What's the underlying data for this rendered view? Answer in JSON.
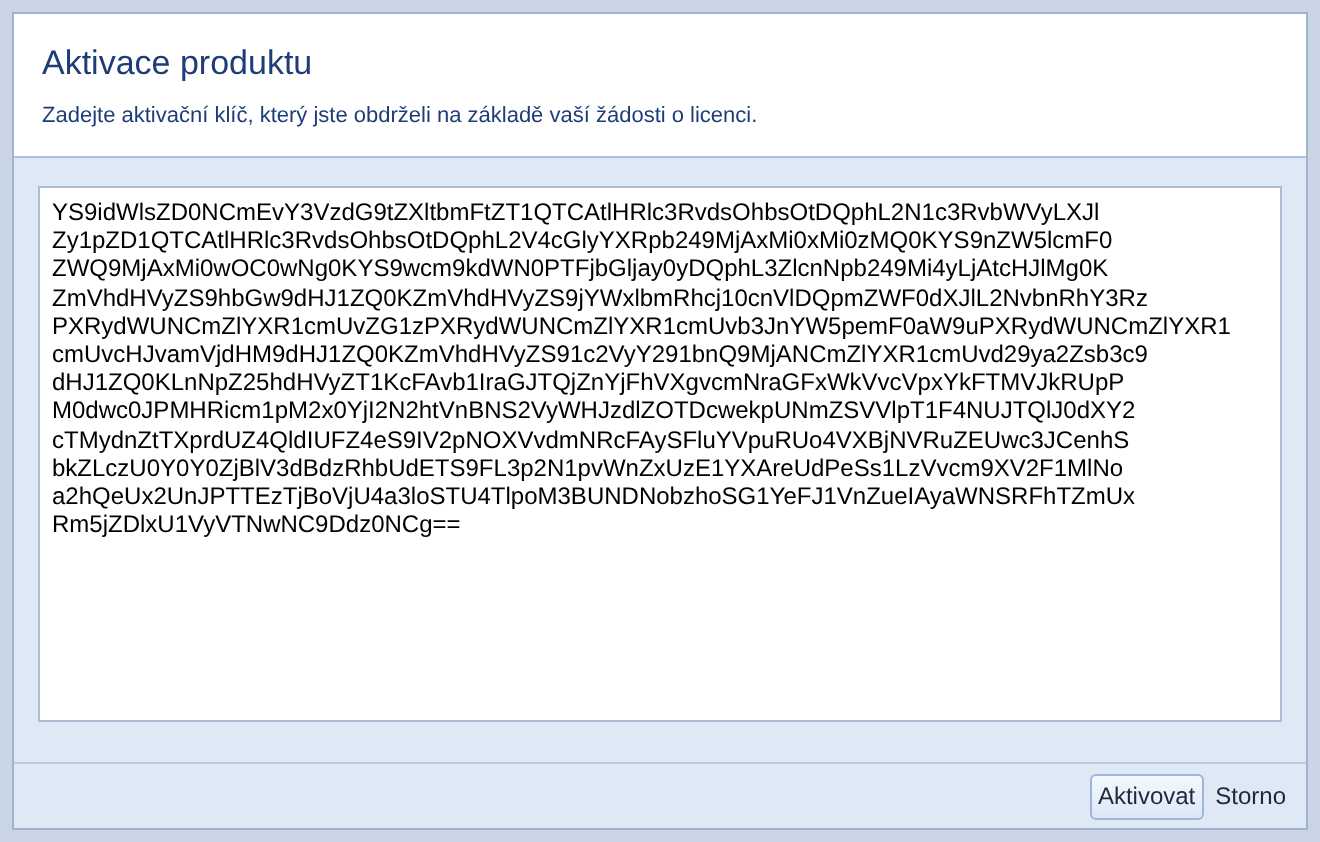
{
  "header": {
    "title": "Aktivace produktu",
    "description": "Zadejte aktivační klíč, který jste obdrželi na základě vaší žádosti o licenci."
  },
  "license_key": {
    "value": "YS9idWlsZD0NCmEvY3VzdG9tZXltbmFtZT1QTCAtlHRlc3RvdsOhbsOtDQphL2N1c3RvbWVyLXJl\nZy1pZD1QTCAtlHRlc3RvdsOhbsOtDQphL2V4cGlyYXRpb249MjAxMi0xMi0zMQ0KYS9nZW5lcmF0\nZWQ9MjAxMi0wOC0wNg0KYS9wcm9kdWN0PTFjbGljay0yDQphL3ZlcnNpb249Mi4yLjAtcHJlMg0K\nZmVhdHVyZS9hbGw9dHJ1ZQ0KZmVhdHVyZS9jYWxlbmRhcj10cnVlDQpmZWF0dXJlL2NvbnRhY3Rz\nPXRydWUNCmZlYXR1cmUvZG1zPXRydWUNCmZlYXR1cmUvb3JnYW5pemF0aW9uPXRydWUNCmZlYXR1\ncmUvcHJvamVjdHM9dHJ1ZQ0KZmVhdHVyZS91c2VyY291bnQ9MjANCmZlYXR1cmUvd29ya2Zsb3c9\ndHJ1ZQ0KLnNpZ25hdHVyZT1KcFAvb1IraGJTQjZnYjFhVXgvcmNraGFxWkVvcVpxYkFTMVJkRUpP\nM0dwc0JPMHRicm1pM2x0YjI2N2htVnBNS2VyWHJzdlZOTDcwekpUNmZSVVlpT1F4NUJTQlJ0dXY2\ncTMydnZtTXprdUZ4QldIUFZ4eS9IV2pNOXVvdmNRcFAySFluYVpuRUo4VXBjNVRuZEUwc3JCenhS\nbkZLczU0Y0Y0ZjBlV3dBdzRhbUdETS9FL3p2N1pvWnZxUzE1YXAreUdPeSs1LzVvcm9XV2F1MlNo\na2hQeUx2UnJPTTEzTjBoVjU4a3loSTU4TlpoM3BUNDNobzhoSG1YeFJ1VnZueIAyaWNSRFhTZmUx\nRm5jZDlxU1VyVTNwNC9Ddz0NCg=="
  },
  "buttons": [
    {
      "label": "Aktivovat",
      "selected": true
    },
    {
      "label": "Storno",
      "selected": false
    }
  ]
}
